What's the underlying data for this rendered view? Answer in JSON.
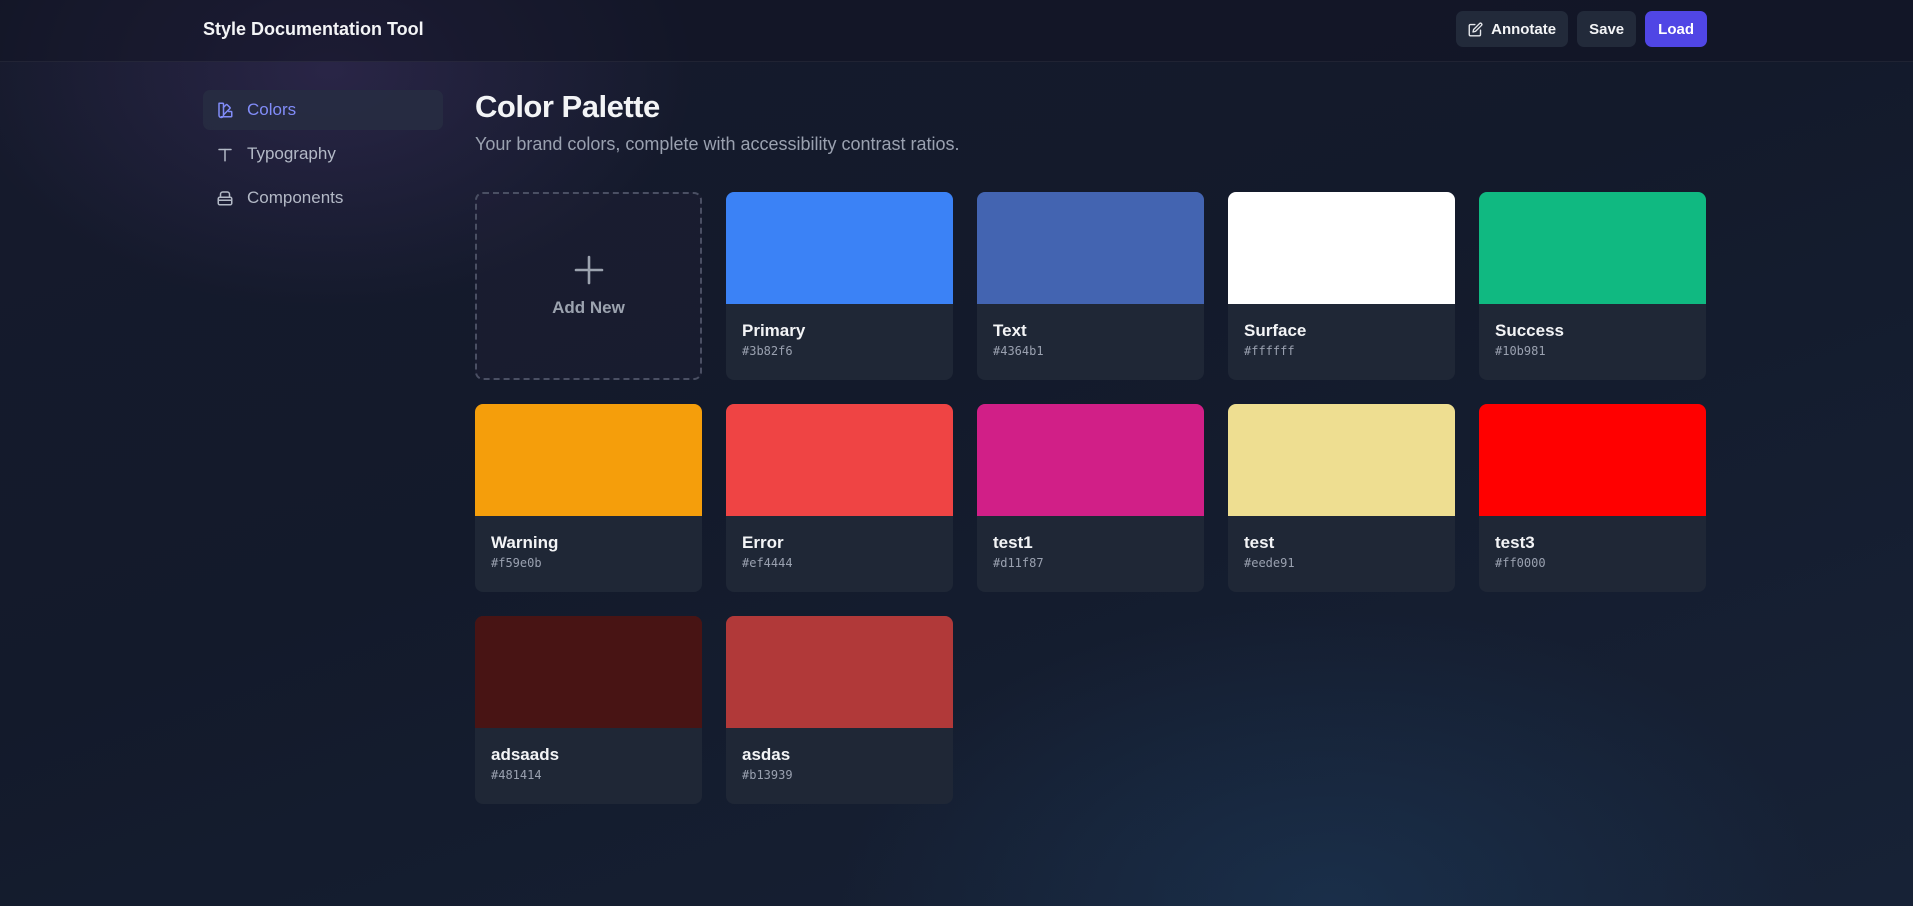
{
  "header": {
    "app_title": "Style Documentation Tool",
    "annotate_label": "Annotate",
    "save_label": "Save",
    "load_label": "Load"
  },
  "sidebar": {
    "items": [
      {
        "label": "Colors",
        "icon": "palette-icon",
        "active": true
      },
      {
        "label": "Typography",
        "icon": "text-icon",
        "active": false
      },
      {
        "label": "Components",
        "icon": "component-icon",
        "active": false
      }
    ]
  },
  "main": {
    "title": "Color Palette",
    "subtitle": "Your brand colors, complete with accessibility contrast ratios.",
    "add_new_label": "Add New",
    "colors": [
      {
        "name": "Primary",
        "hex": "#3b82f6"
      },
      {
        "name": "Text",
        "hex": "#4364b1"
      },
      {
        "name": "Surface",
        "hex": "#ffffff"
      },
      {
        "name": "Success",
        "hex": "#10b981"
      },
      {
        "name": "Warning",
        "hex": "#f59e0b"
      },
      {
        "name": "Error",
        "hex": "#ef4444"
      },
      {
        "name": "test1",
        "hex": "#d11f87"
      },
      {
        "name": "test",
        "hex": "#eede91"
      },
      {
        "name": "test3",
        "hex": "#ff0000"
      },
      {
        "name": "adsaads",
        "hex": "#481414"
      },
      {
        "name": "asdas",
        "hex": "#b13939"
      }
    ]
  },
  "theme": {
    "accent": "#5046e5",
    "active_nav": "#818cf8"
  }
}
